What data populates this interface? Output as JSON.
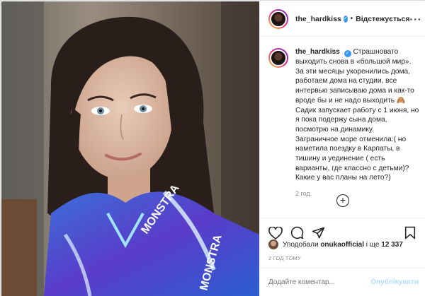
{
  "post": {
    "photo_alt": "Selfie photo",
    "photo_text": "MONSTRA",
    "username": "the_hardkiss",
    "verified_mark": "✓",
    "separator": "•",
    "follow_label": "Відстежується",
    "more_label": "···",
    "caption_lines": [
      "Страшновато",
      "выходить снова в «большой мир».",
      "За эти месяцы укоренились дома,",
      "работаем дома на студии, все",
      "интервью записываю дома и как-то",
      "вроде бы и не надо выходить 🙈",
      "Садик запускает работу с 1 июня, но",
      "я пока подержу сына дома,",
      "посмотрю на динамику.",
      "Заграничное море отменила:( но",
      "наметила поездку в Карпаты, в",
      "тишину и уединение ( есть",
      "варианты, где классно с детьми)?",
      "Какие у вас планы на лето?)"
    ],
    "caption_time": "2 год.",
    "load_more_label": "+",
    "likes_prefix": "Уподобали",
    "likes_user": "onukaofficial",
    "likes_middle": "і ще",
    "likes_count": "12 337",
    "time_ago": "2 ГОД ТОМУ",
    "comment_placeholder": "Додайте коментар...",
    "publish_label": "Опублікувати",
    "icons": [
      "heart-icon",
      "comment-icon",
      "share-icon",
      "bookmark-icon",
      "add-circle-icon"
    ]
  }
}
